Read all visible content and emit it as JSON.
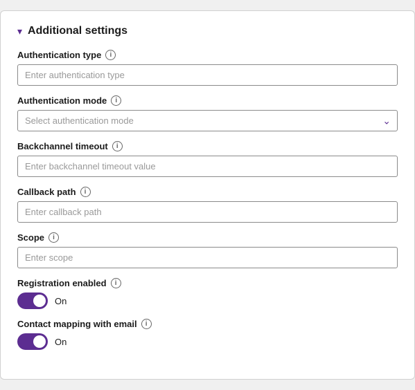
{
  "section": {
    "title": "Additional settings",
    "chevron": "▾"
  },
  "fields": {
    "auth_type": {
      "label": "Authentication type",
      "placeholder": "Enter authentication type"
    },
    "auth_mode": {
      "label": "Authentication mode",
      "placeholder": "Select authentication mode"
    },
    "backchannel_timeout": {
      "label": "Backchannel timeout",
      "placeholder": "Enter backchannel timeout value"
    },
    "callback_path": {
      "label": "Callback path",
      "placeholder": "Enter callback path"
    },
    "scope": {
      "label": "Scope",
      "placeholder": "Enter scope"
    }
  },
  "toggles": {
    "registration_enabled": {
      "label": "Registration enabled",
      "status": "On",
      "checked": true
    },
    "contact_mapping": {
      "label": "Contact mapping with email",
      "status": "On",
      "checked": true
    }
  }
}
